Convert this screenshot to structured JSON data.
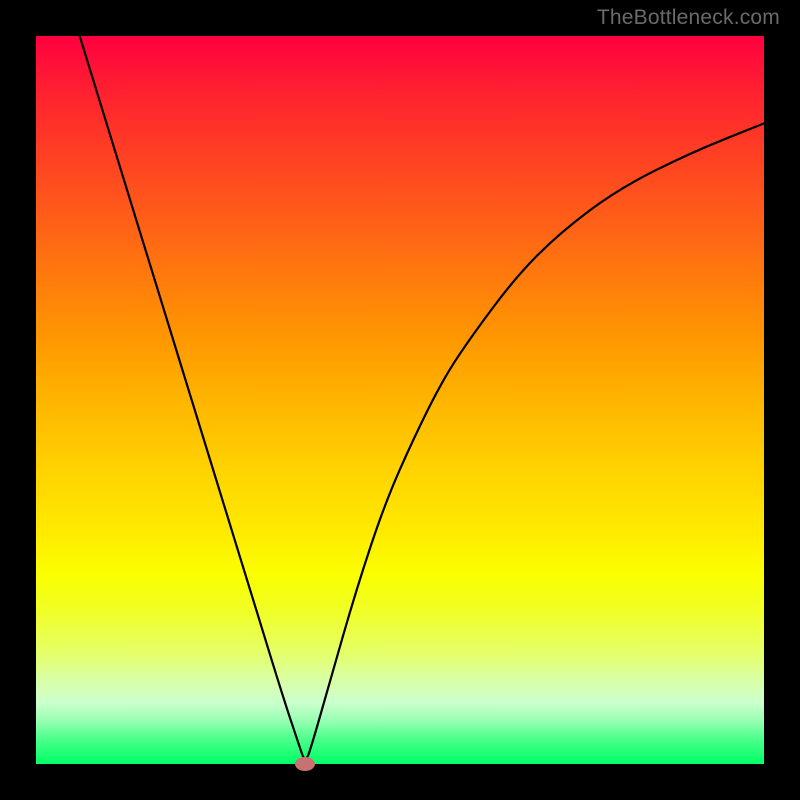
{
  "watermark": "TheBottleneck.com",
  "colors": {
    "background": "#000000",
    "gradient_top": "#ff0040",
    "gradient_mid": "#ffea00",
    "gradient_bottom": "#00ff66",
    "curve": "#000000",
    "marker": "#c97070"
  },
  "chart_data": {
    "type": "line",
    "title": "",
    "xlabel": "",
    "ylabel": "",
    "xlim": [
      0,
      100
    ],
    "ylim": [
      0,
      100
    ],
    "grid": false,
    "legend": false,
    "series": [
      {
        "name": "bottleneck-curve",
        "x": [
          6,
          10,
          14,
          18,
          22,
          26,
          30,
          34,
          36,
          37,
          38,
          40,
          44,
          48,
          52,
          56,
          60,
          66,
          72,
          80,
          90,
          100
        ],
        "values": [
          100,
          87,
          74,
          61,
          48,
          35,
          22,
          9,
          3,
          0,
          3,
          10,
          24,
          36,
          45,
          53,
          59,
          67,
          73,
          79,
          84,
          88
        ]
      }
    ],
    "markers": [
      {
        "name": "minimum-marker",
        "x": 37,
        "y": 0
      }
    ]
  }
}
